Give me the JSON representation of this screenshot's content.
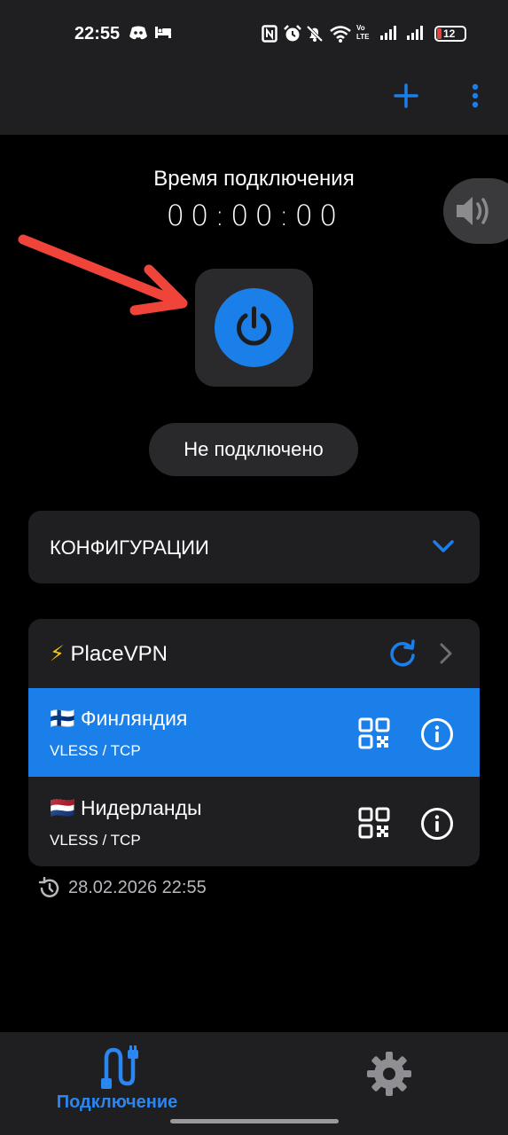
{
  "status_bar": {
    "time": "22:55",
    "network_label": "Vo LTE",
    "battery_level": "12",
    "icons": [
      "discord-icon",
      "bed-icon",
      "nfc-icon",
      "alarm-icon",
      "mute-icon",
      "wifi-icon",
      "volte-icon",
      "signal-icon",
      "signal-icon",
      "battery-icon"
    ]
  },
  "app_bar": {
    "actions": [
      "add-icon",
      "more-vert-icon"
    ]
  },
  "timer": {
    "label": "Время подключения",
    "value": "00:00:00"
  },
  "power": {
    "icon": "power-icon"
  },
  "connection_status": "Не подключено",
  "configs": {
    "title": "КОНФИГУРАЦИИ",
    "icon": "chevron-down-icon"
  },
  "group": {
    "icon": "⚡",
    "name": "PlaceVPN",
    "actions": [
      "refresh-icon",
      "chevron-right-icon"
    ]
  },
  "servers": [
    {
      "flag": "🇫🇮",
      "name": "Финляндия",
      "protocol": "VLESS / TCP",
      "selected": true
    },
    {
      "flag": "🇳🇱",
      "name": "Нидерланды",
      "protocol": "VLESS / TCP",
      "selected": false
    }
  ],
  "last_update": {
    "icon": "history-icon",
    "text": "28.02.2026 22:55"
  },
  "bottom_nav": {
    "connect_label": "Подключение",
    "connect_icon": "cable-icon",
    "settings_icon": "gear-icon"
  },
  "colors": {
    "accent": "#1a7fe8",
    "background": "#000000",
    "surface": "#1f1f22",
    "annotation_arrow": "#f0443a"
  }
}
